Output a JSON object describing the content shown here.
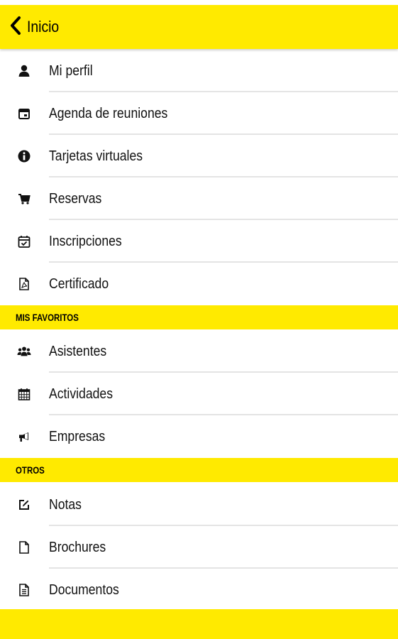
{
  "header": {
    "back_label": "Inicio"
  },
  "menu": [
    {
      "label": "Mi perfil",
      "icon": "user-icon"
    },
    {
      "label": "Agenda de reuniones",
      "icon": "calendar-icon"
    },
    {
      "label": "Tarjetas virtuales",
      "icon": "info-icon"
    },
    {
      "label": "Reservas",
      "icon": "cart-icon"
    },
    {
      "label": "Inscripciones",
      "icon": "calendar-check-icon"
    },
    {
      "label": "Certificado",
      "icon": "pdf-file-icon"
    }
  ],
  "favoritos": {
    "title": "MIS FAVORITOS",
    "items": [
      {
        "label": "Asistentes",
        "icon": "users-icon"
      },
      {
        "label": "Actividades",
        "icon": "calendar-grid-icon"
      },
      {
        "label": "Empresas",
        "icon": "megaphone-icon"
      }
    ]
  },
  "otros": {
    "title": "OTROS",
    "items": [
      {
        "label": "Notas",
        "icon": "edit-icon"
      },
      {
        "label": "Brochures",
        "icon": "file-icon"
      },
      {
        "label": "Documentos",
        "icon": "document-text-icon"
      }
    ]
  },
  "colors": {
    "accent": "#ffea00",
    "separator": "#e4e4e4",
    "text": "#111111"
  }
}
